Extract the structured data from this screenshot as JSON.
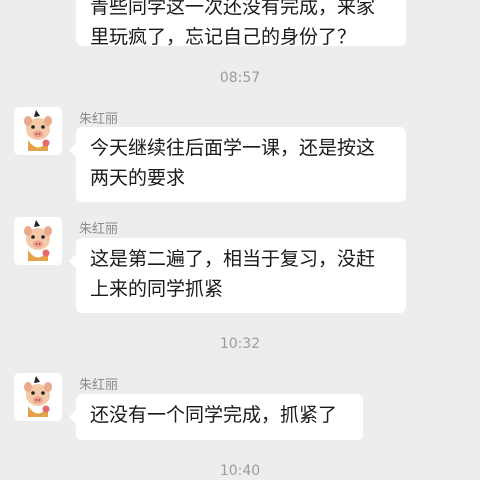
{
  "messages_top": {
    "line1": "青些同学这一次还没有完成，来家",
    "line2": "里玩疯了，忘记自己的身份了？"
  },
  "timestamps": [
    "08:57",
    "10:32",
    "10:40"
  ],
  "messages": [
    {
      "sender": "朱红丽",
      "line1": "今天继续往后面学一课，还是按这",
      "line2": "两天的要求"
    },
    {
      "sender": "朱红丽",
      "line1": "这是第二遍了，相当于复习，没赶",
      "line2": "上来的同学抓紧"
    },
    {
      "sender": "朱红丽",
      "line1": "还没有一个同学完成，抓紧了"
    }
  ],
  "colors": {
    "background": "#ededed",
    "bubble": "#ffffff",
    "text": "#1a1a1a",
    "meta": "#9b9b9b"
  },
  "icons": {
    "avatar": "cartoon-pig-avatar-icon"
  }
}
